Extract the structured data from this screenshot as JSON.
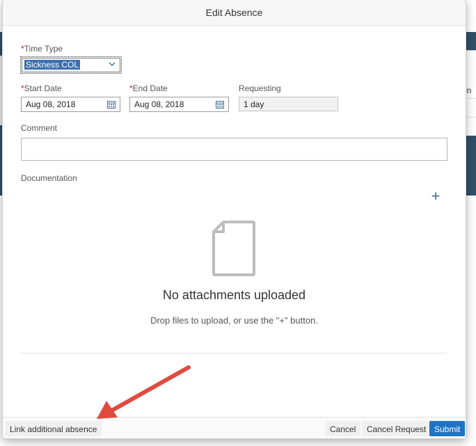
{
  "dialog": {
    "title": "Edit Absence"
  },
  "form": {
    "time_type": {
      "label": "Time Type",
      "required_marker": "*",
      "value": "Sickness COL"
    },
    "start_date": {
      "label": "Start Date",
      "required_marker": "*",
      "value": "Aug 08, 2018"
    },
    "end_date": {
      "label": "End Date",
      "required_marker": "*",
      "value": "Aug 08, 2018"
    },
    "requesting": {
      "label": "Requesting",
      "value": "1 day"
    },
    "comment": {
      "label": "Comment",
      "value": ""
    }
  },
  "documentation": {
    "label": "Documentation",
    "add_glyph": "+",
    "empty_title": "No attachments uploaded",
    "empty_subtitle": "Drop files to upload, or use the \"+\" button."
  },
  "footer": {
    "link_label": "Link additional absence",
    "cancel_label": "Cancel",
    "cancel_request_label": "Cancel Request",
    "submit_label": "Submit"
  },
  "background": {
    "partial_text": "on"
  },
  "colors": {
    "accent": "#1e74c4",
    "required": "#e01b22",
    "arrow": "#e04a3f",
    "header_bg": "#f7f7f7",
    "backdrop_band": "#2f4f6a"
  },
  "icons": [
    "calendar-icon",
    "chevron-down-icon",
    "plus-icon",
    "document-icon",
    "annotation-arrow"
  ]
}
